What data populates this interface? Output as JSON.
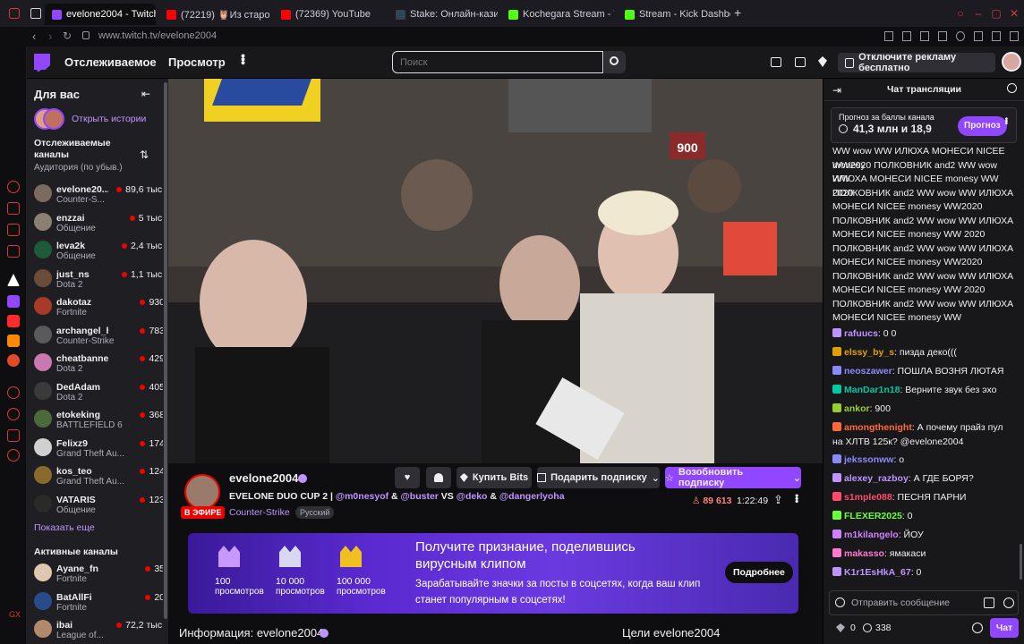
{
  "browser": {
    "tabs": [
      {
        "label": "evelone2004 - Twitch",
        "color": "#9146ff",
        "active": true
      },
      {
        "label": "(72219) 🦉Из старой ХР",
        "color": "#ff0000"
      },
      {
        "label": "(72369) YouTube",
        "color": "#ff0000"
      },
      {
        "label": "Stake: Онлайн-казино и",
        "color": "#2f4553"
      },
      {
        "label": "Kochegara Stream - Wat",
        "color": "#53fc18"
      },
      {
        "label": "Stream - Kick Dashboard",
        "color": "#53fc18"
      }
    ],
    "url": "www.twitch.tv/evelone2004"
  },
  "topnav": {
    "following": "Отслеживаемое",
    "browse": "Просмотр",
    "search_placeholder": "Поиск",
    "ad_free": "Отключите рекламу бесплатно"
  },
  "sidebar": {
    "for_you": "Для вас",
    "open_stories": "Открыть истории",
    "followed_title": "Отслеживаемые каналы",
    "followed_sort": "Аудитория (по убыв.)",
    "followed": [
      {
        "name": "evelone20...",
        "game": "Counter-S...",
        "viewers": "89,6 тыс.",
        "color": "#7a6a60"
      },
      {
        "name": "enzzai",
        "game": "Общение",
        "viewers": "5 тыс.",
        "color": "#8a7f72"
      },
      {
        "name": "leva2k",
        "game": "Общение",
        "viewers": "2,4 тыс.",
        "color": "#1e5a3a"
      },
      {
        "name": "just_ns",
        "game": "Dota 2",
        "viewers": "1,1 тыс.",
        "color": "#6b4b3a"
      },
      {
        "name": "dakotaz",
        "game": "Fortnite",
        "viewers": "930",
        "color": "#a83a2a"
      },
      {
        "name": "archangel_hs",
        "game": "Counter-Strike",
        "viewers": "783",
        "color": "#5a5a5a"
      },
      {
        "name": "cheatbanned",
        "game": "Dota 2",
        "viewers": "429",
        "color": "#c87ab0"
      },
      {
        "name": "DedAdam",
        "game": "Dota 2",
        "viewers": "405",
        "color": "#3a3a3a"
      },
      {
        "name": "etokeking",
        "game": "BATTLEFIELD 6",
        "viewers": "368",
        "color": "#4a6a3a"
      },
      {
        "name": "Felixz9",
        "game": "Grand Theft Au...",
        "viewers": "174",
        "color": "#d0d0d0"
      },
      {
        "name": "kos_teo",
        "game": "Grand Theft Au...",
        "viewers": "124",
        "color": "#8a6a2a"
      },
      {
        "name": "VATARIS",
        "game": "Общение",
        "viewers": "123",
        "color": "#2a2a2a"
      }
    ],
    "show_more": "Показать еще",
    "active_title": "Активные каналы",
    "active": [
      {
        "name": "Ayane_fn",
        "game": "Fortnite",
        "viewers": "35",
        "color": "#e0c8b0"
      },
      {
        "name": "BatAllFi",
        "game": "Fortnite",
        "viewers": "20",
        "color": "#2a4a8a"
      },
      {
        "name": "ibai",
        "game": "League of...",
        "viewers": "72,2 тыс.",
        "color": "#b08a6a"
      }
    ]
  },
  "video": {
    "scoreboard": "900"
  },
  "stream": {
    "channel": "evelone2004",
    "live_badge": "В ЭФИРЕ",
    "title_parts": [
      {
        "text": "EVELONE DUO CUP 2 | ",
        "color": "#efeff1"
      },
      {
        "text": "@m0nesyof",
        "color": "#bf94ff"
      },
      {
        "text": " & ",
        "color": "#efeff1"
      },
      {
        "text": "@buster",
        "color": "#bf94ff"
      },
      {
        "text": " VS ",
        "color": "#efeff1"
      },
      {
        "text": "@deko",
        "color": "#bf94ff"
      },
      {
        "text": " & ",
        "color": "#efeff1"
      },
      {
        "text": "@dangerlyoha",
        "color": "#bf94ff"
      }
    ],
    "category": "Counter-Strike",
    "tag": "Русский",
    "buy_bits": "Купить Bits",
    "gift_sub": "Подарить подписку",
    "renew_sub": "Возобновить подписку",
    "viewers": "89 613",
    "uptime": "1:22:49"
  },
  "banner": {
    "tiers": [
      {
        "count": "100",
        "label": "просмотров"
      },
      {
        "count": "10 000",
        "label": "просмотров"
      },
      {
        "count": "100 000",
        "label": "просмотров"
      }
    ],
    "headline": "Получите признание, поделившись вирусным клипом",
    "body": "Зарабатывайте значки за посты в соцсетях, когда ваш клип станет популярным в соцсетях!",
    "cta": "Подробнее"
  },
  "about": {
    "info_title": "Информация: evelone2004",
    "goals_title": "Цели evelone2004"
  },
  "chat": {
    "header": "Чат трансляции",
    "prediction_title": "Прогноз за баллы канала",
    "prediction_value": "41,3 млн и 18,9",
    "prediction_button": "Прогноз",
    "spam_lines": [
      "WW wow WW ИЛЮХА МОНЕСИ NICEE monesy",
      "WW2020 ПОЛКОВНИК and2 WW wow WW",
      "ИЛЮХА МОНЕСИ NICEE monesy WW 2020",
      "ПОЛКОВНИК and2 WW wow WW ИЛЮХА",
      "МОНЕСИ NICEE monesy WW2020",
      "ПОЛКОВНИК and2 WW wow WW ИЛЮХА",
      "МОНЕСИ NICEE monesy WW 2020",
      "ПОЛКОВНИК and2 WW wow WW ИЛЮХА",
      "МОНЕСИ NICEE monesy WW2020",
      "ПОЛКОВНИК and2 WW wow WW ИЛЮХА",
      "МОНЕСИ NICEE monesy WW 2020",
      "ПОЛКОВНИК and2 WW wow WW ИЛЮХА",
      "МОНЕСИ NICEE monesy WW"
    ],
    "messages": [
      {
        "user": "rafuucs",
        "text": ": 0 0",
        "color": "#bf94ff"
      },
      {
        "user": "elssy_by_s",
        "text": ": пизда деко(((",
        "color": "#e0a000"
      },
      {
        "user": "neoszawer",
        "text": ": ПОШЛА ВОЗНЯ ЛЮТАЯ",
        "color": "#8a8aff"
      },
      {
        "user": "ManDar1n18",
        "text": ": Верните звук без эхо",
        "color": "#00c8a0"
      },
      {
        "user": "ankor",
        "text": ": 900",
        "color": "#9acd32"
      },
      {
        "user": "amongthenight",
        "text": ": А почему прайз пул на ХЛТВ 125к? @evelone2004",
        "color": "#ff6a3a"
      },
      {
        "user": "jekssonww",
        "text": ": о",
        "color": "#8a8aff"
      },
      {
        "user": "alexey_razboy",
        "text": ": А ГДЕ БОРЯ?",
        "color": "#bf94ff"
      },
      {
        "user": "s1mple088",
        "text": ": ПЕСНЯ ПАРНИ",
        "color": "#ff4a6a"
      },
      {
        "user": "FLEXER2025",
        "text": ": 0",
        "color": "#6aff3a"
      },
      {
        "user": "m1kilangelo",
        "text": ": ЙОУ",
        "color": "#d080ff"
      },
      {
        "user": "makasso",
        "text": ": ямакаси",
        "color": "#ff7ad0"
      },
      {
        "user": "K1r1EsHkA_67",
        "text": ": 0",
        "color": "#bf94ff"
      }
    ],
    "input_placeholder": "Отправить сообщение",
    "points": "0",
    "points2": "338",
    "send": "Чат"
  }
}
